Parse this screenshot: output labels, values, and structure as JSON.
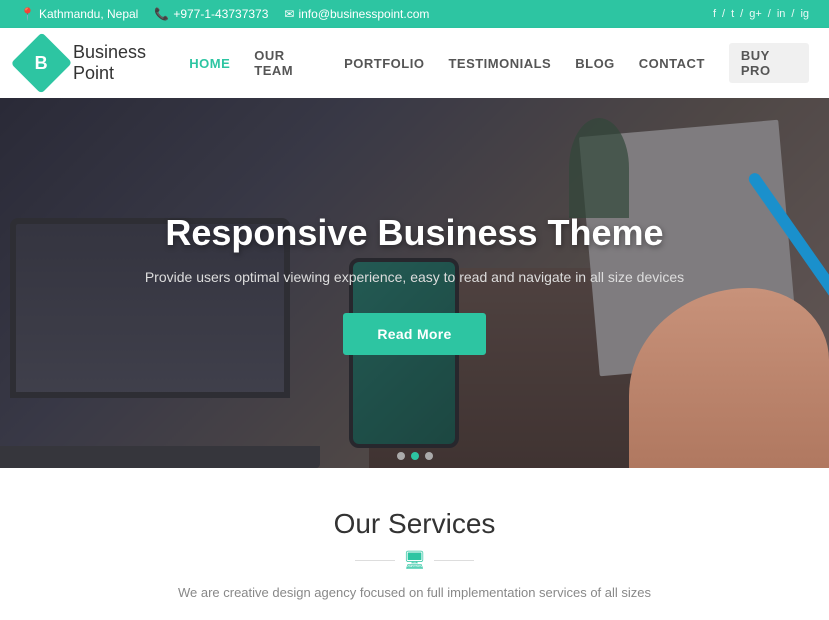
{
  "topbar": {
    "location": "Kathmandu, Nepal",
    "phone": "+977-1-43737373",
    "email": "info@businesspoint.com",
    "social": [
      "f",
      "/",
      "t",
      "/",
      "g+",
      "/",
      "in"
    ]
  },
  "header": {
    "logo_letter": "B",
    "logo_text": "Business  Point",
    "nav": [
      {
        "label": "HOME",
        "active": true
      },
      {
        "label": "OUR TEAM",
        "active": false
      },
      {
        "label": "PORTFOLIO",
        "active": false
      },
      {
        "label": "TESTIMONIALS",
        "active": false
      },
      {
        "label": "BLOG",
        "active": false
      },
      {
        "label": "CONTACT",
        "active": false
      },
      {
        "label": "BUY PRO",
        "active": false
      }
    ]
  },
  "hero": {
    "title": "Responsive Business Theme",
    "subtitle": "Provide users optimal viewing experience, easy to read and navigate in all size devices",
    "cta_label": "Read more",
    "dots": [
      false,
      true,
      false
    ]
  },
  "services": {
    "title": "Our Services",
    "subtitle": "We are creative design agency focused on full implementation services of all sizes",
    "divider_icon": "▭"
  }
}
